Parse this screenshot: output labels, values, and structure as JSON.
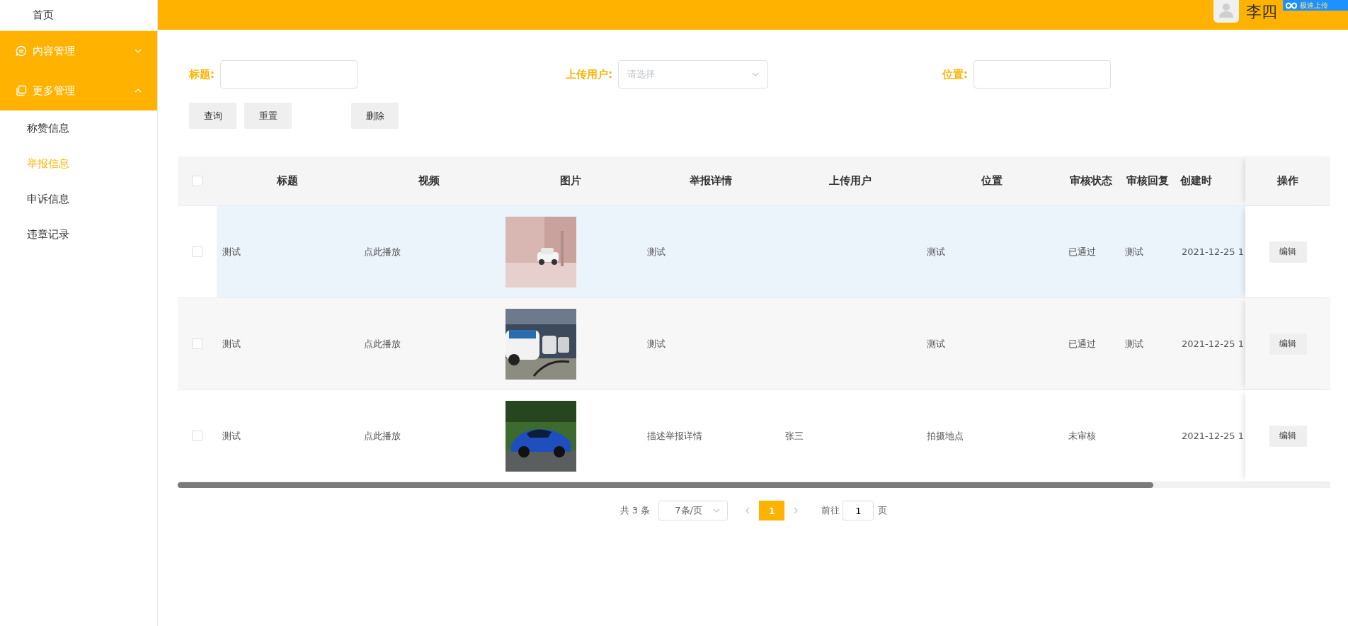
{
  "header": {
    "user_name": "李四",
    "upload_badge": "极速上传"
  },
  "sidebar": {
    "items": [
      {
        "kind": "link",
        "label": "首页"
      },
      {
        "kind": "group",
        "label": "内容管理",
        "expanded": false
      },
      {
        "kind": "group",
        "label": "更多管理",
        "expanded": true,
        "children": [
          {
            "label": "称赞信息",
            "selected": false
          },
          {
            "label": "举报信息",
            "selected": true
          },
          {
            "label": "申诉信息",
            "selected": false
          },
          {
            "label": "违章记录",
            "selected": false
          }
        ]
      }
    ]
  },
  "filters": [
    {
      "kind": "input",
      "label": "标题:"
    },
    {
      "kind": "select",
      "label": "上传用户:",
      "placeholder": "请选择"
    },
    {
      "kind": "input",
      "label": "位置:"
    }
  ],
  "buttons": [
    "查询",
    "重置",
    "删除"
  ],
  "table": {
    "all_checked": false,
    "columns": [
      "标题",
      "视频",
      "图片",
      "举报详情",
      "上传用户",
      "位置",
      "审核状态",
      "审核回复",
      "创建时",
      "操作"
    ],
    "rows": [
      {
        "checked": false,
        "hovered": true,
        "title": "测试",
        "video": "点此播放",
        "detail": "测试",
        "location": "测试",
        "status": "已通过",
        "reply": "测试",
        "created": "2021-12-25 1",
        "action": "编辑"
      },
      {
        "checked": false,
        "hovered": false,
        "title": "测试",
        "video": "点此播放",
        "detail": "测试",
        "location": "测试",
        "status": "已通过",
        "reply": "测试",
        "created": "2021-12-25 1",
        "action": "编辑"
      },
      {
        "checked": false,
        "hovered": false,
        "title": "测试",
        "video": "点此播放",
        "detail": "描述举报详情",
        "user": "张三",
        "location": "拍摄地点",
        "status": "未审核",
        "created": "2021-12-25 1",
        "action": "编辑"
      }
    ]
  },
  "pagination": {
    "total": "共 3 条",
    "page_size": "7条/页",
    "pages": [
      {
        "label": "1",
        "selected": true
      }
    ],
    "goto_label": "前往",
    "goto_value": "1",
    "goto_suffix": "页"
  }
}
